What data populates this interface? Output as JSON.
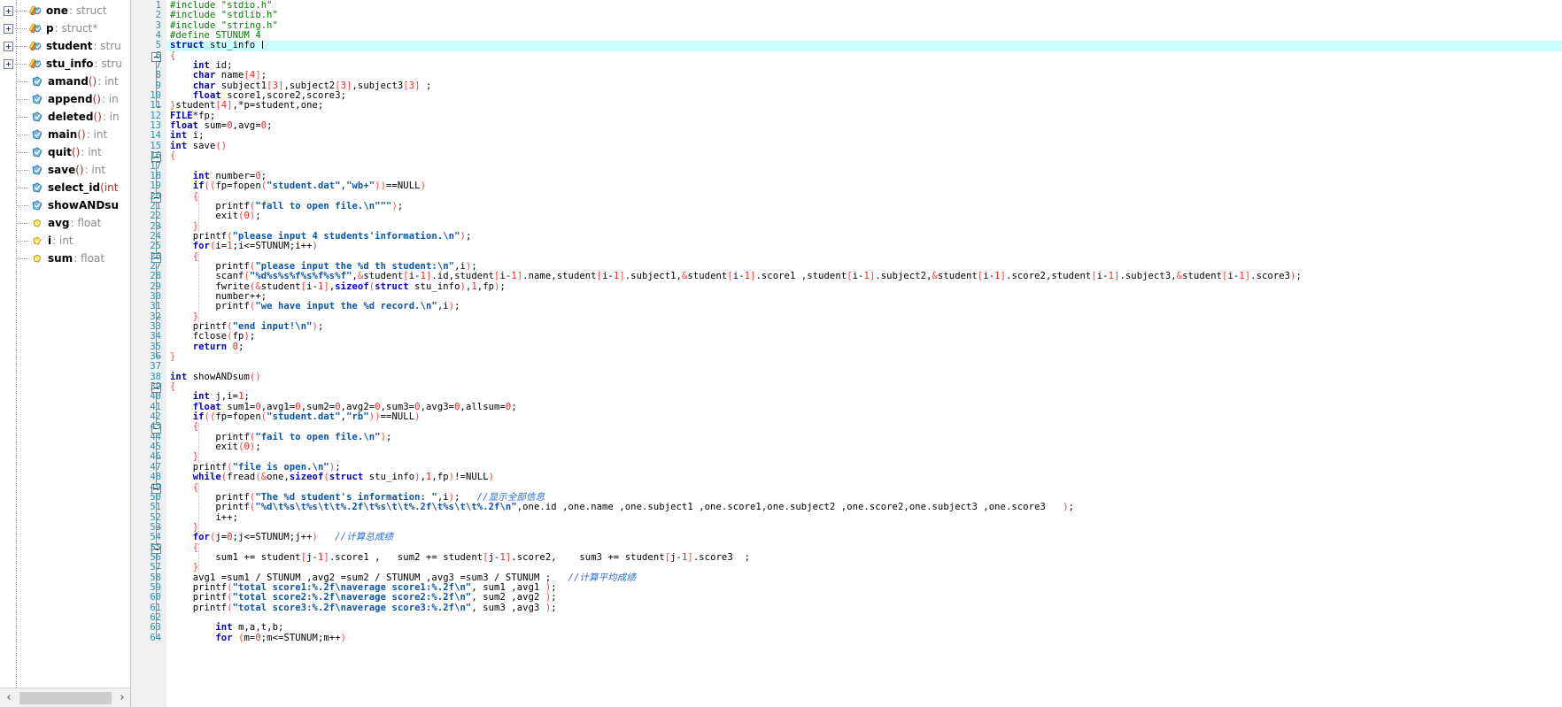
{
  "sidebar": {
    "name": "class-view-tree",
    "items": [
      {
        "expander": true,
        "icon": "struct-icon",
        "label": "one",
        "type": ": struct"
      },
      {
        "expander": true,
        "icon": "struct-icon",
        "label": "p",
        "type": ": struct*"
      },
      {
        "expander": true,
        "icon": "struct-icon",
        "label": "student",
        "type": ": stru"
      },
      {
        "expander": true,
        "icon": "struct-icon",
        "label": "stu_info",
        "type": ": stru"
      },
      {
        "expander": false,
        "icon": "method-icon",
        "label": "amand",
        "paren": "()",
        "type": ": int"
      },
      {
        "expander": false,
        "icon": "method-icon",
        "label": "append",
        "paren": "()",
        "type": ": in"
      },
      {
        "expander": false,
        "icon": "method-icon",
        "label": "deleted",
        "paren": "()",
        "type": ": in"
      },
      {
        "expander": false,
        "icon": "method-icon",
        "label": "main",
        "paren": "()",
        "type": ": int"
      },
      {
        "expander": false,
        "icon": "method-icon",
        "label": "quit",
        "paren": "()",
        "type": ": int"
      },
      {
        "expander": false,
        "icon": "method-icon",
        "label": "save",
        "paren": "()",
        "type": ": int"
      },
      {
        "expander": false,
        "icon": "method-icon",
        "label": "select_id",
        "paren": "(int ",
        "type": ""
      },
      {
        "expander": false,
        "icon": "method-icon",
        "label": "showANDsu",
        "paren": "",
        "type": ""
      },
      {
        "expander": false,
        "icon": "field-icon",
        "label": "avg",
        "type": ": float"
      },
      {
        "expander": false,
        "icon": "field-icon",
        "label": "i",
        "type": ": int"
      },
      {
        "expander": false,
        "icon": "field-icon",
        "label": "sum",
        "type": ": float"
      }
    ],
    "hscroll": {
      "left_arrow": "‹",
      "right_arrow": "›"
    }
  },
  "editor": {
    "name": "c-source-editor",
    "current_line": 5,
    "first_line_number": 1,
    "last_line_number": 64,
    "colors": {
      "preprocessor": "#008000",
      "keyword": "#0000c8",
      "string": "#0b54a8",
      "number": "#ff2020",
      "punctuation": "#ff4040",
      "comment": "#2b6cd4",
      "line_number": "#2b91af",
      "current_line_bg": "#ccffff",
      "gutter_bg": "#f0f0f0"
    },
    "line_numbers": [
      1,
      2,
      3,
      4,
      5,
      6,
      7,
      8,
      9,
      10,
      11,
      12,
      13,
      14,
      15,
      16,
      17,
      18,
      19,
      20,
      21,
      22,
      23,
      24,
      25,
      26,
      27,
      28,
      29,
      30,
      31,
      32,
      33,
      34,
      35,
      36,
      37,
      38,
      39,
      40,
      41,
      42,
      43,
      44,
      45,
      46,
      47,
      48,
      49,
      50,
      51,
      52,
      53,
      54,
      55,
      56,
      57,
      58,
      59,
      60,
      61,
      62,
      63,
      64
    ],
    "lines": [
      "#include \"stdio.h\"",
      "#include \"stdlib.h\"",
      "#include \"string.h\"",
      "#define STUNUM 4",
      "struct stu_info ",
      "{",
      "    int id;",
      "    char name[4];",
      "    char subject1[3],subject2[3],subject3[3] ;",
      "    float score1,score2,score3;",
      "}student[4],*p=student,one;",
      "FILE*fp;",
      "float sum=0,avg=0;",
      "int i;",
      "int save()",
      "{",
      "",
      "    int number=0;",
      "    if((fp=fopen(\"student.dat\",\"wb+\"))==NULL)",
      "    {",
      "        printf(\"fall to open file.\\n\"\"\");",
      "        exit(0);",
      "    }",
      "    printf(\"please input 4 students'information.\\n\");",
      "    for(i=1;i<=STUNUM;i++)",
      "    {",
      "        printf(\"please input the %d th student:\\n\",i);",
      "        scanf(\"%d%s%s%f%s%f%s%f\",&student[i-1].id,student[i-1].name,student[i-1].subject1,&student[i-1].score1 ,student[i-1].subject2,&student[i-1].score2,student[i-1].subject3,&student[i-1].score3);",
      "        fwrite(&student[i-1],sizeof(struct stu_info),1,fp);",
      "        number++;",
      "        printf(\"we have input the %d record.\\n\",i);",
      "    }",
      "    printf(\"end input!\\n\");",
      "    fclose(fp);",
      "    return 0;",
      "}",
      "",
      "int showANDsum()",
      "{",
      "    int j,i=1;",
      "    float sum1=0,avg1=0,sum2=0,avg2=0,sum3=0,avg3=0,allsum=0;",
      "    if((fp=fopen(\"student.dat\",\"rb\"))==NULL)",
      "    {",
      "        printf(\"fail to open file.\\n\");",
      "        exit(0);",
      "    }",
      "    printf(\"file is open.\\n\");",
      "    while(fread(&one,sizeof(struct stu_info),1,fp)!=NULL)",
      "    {",
      "        printf(\"The %d student's information: \",i);   //显示全部信息",
      "        printf(\"%d\\t%s\\t%s\\t\\t%.2f\\t%s\\t\\t%.2f\\t%s\\t\\t%.2f\\n\",one.id ,one.name ,one.subject1 ,one.score1,one.subject2 ,one.score2,one.subject3 ,one.score3   );",
      "        i++;",
      "    }",
      "    for(j=0;j<=STUNUM;j++)   //计算总成绩",
      "    {",
      "        sum1 += student[j-1].score1 ,   sum2 += student[j-1].score2,    sum3 += student[j-1].score3  ;",
      "    }",
      "    avg1 =sum1 / STUNUM ,avg2 =sum2 / STUNUM ,avg3 =sum3 / STUNUM ;   //计算平均成绩",
      "    printf(\"total score1:%.2f\\naverage score1:%.2f\\n\", sum1 ,avg1 );",
      "    printf(\"total score2:%.2f\\naverage score2:%.2f\\n\", sum2 ,avg2 );",
      "    printf(\"total score3:%.2f\\naverage score3:%.2f\\n\", sum3 ,avg3 );",
      "",
      "        int m,a,t,b;",
      "        for (m=0;m<=STUNUM;m++)"
    ],
    "comments": {
      "line50": "//显示全部信息",
      "line54": "//计算总成绩",
      "line58": "//计算平均成绩"
    },
    "fold_markers": [
      6,
      16,
      20,
      26,
      39,
      43,
      49,
      55
    ]
  }
}
